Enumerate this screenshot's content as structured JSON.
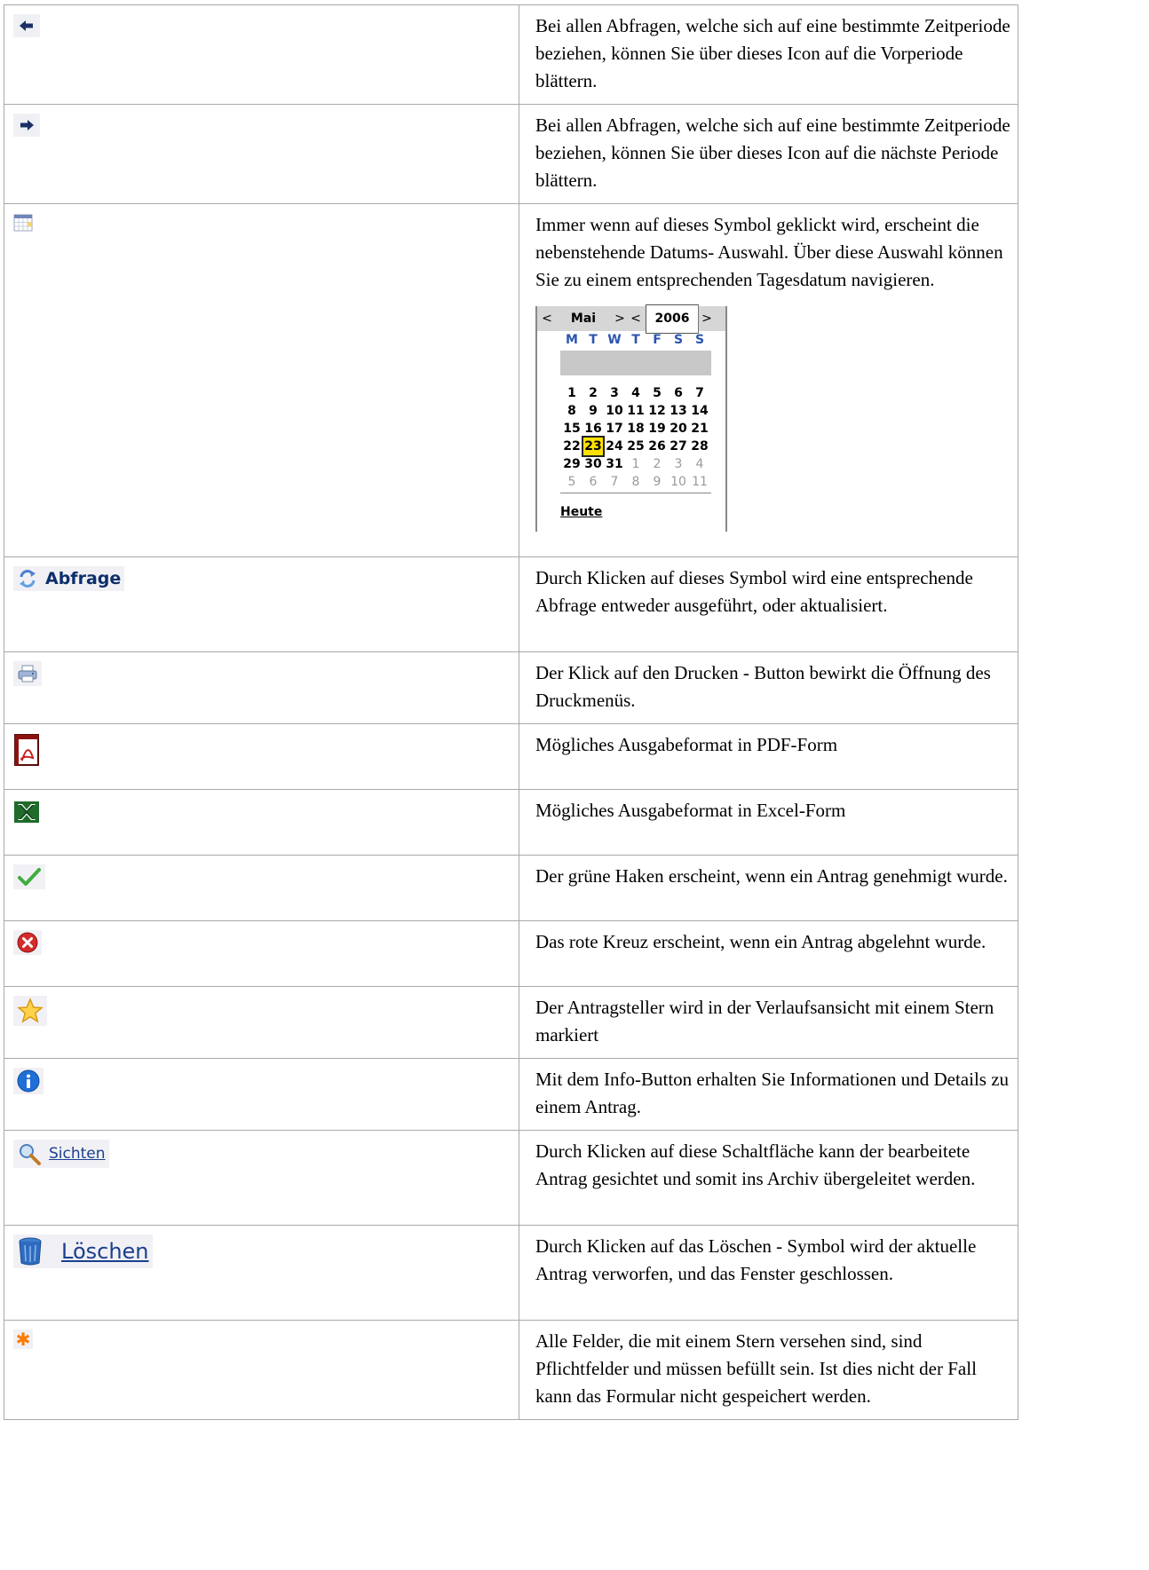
{
  "rows": [
    {
      "icon": "arrow-left-icon",
      "text": "Bei allen Abfragen, welche sich auf eine bestimmte Zeitperiode beziehen, können Sie über dieses Icon auf die Vorperiode blättern."
    },
    {
      "icon": "arrow-right-icon",
      "text": "Bei allen Abfragen, welche sich auf eine bestimmte Zeitperiode beziehen, können Sie über dieses Icon auf die nächste Periode blättern."
    },
    {
      "icon": "calendar-icon",
      "text": "Immer wenn auf dieses Symbol geklickt wird, erscheint die nebenstehende Datums- Auswahl. Über diese Auswahl können Sie zu einem entsprechenden Tagesdatum navigieren."
    },
    {
      "icon": "refresh-icon",
      "label": "Abfrage",
      "text": "Durch Klicken auf dieses Symbol wird eine entsprechende Abfrage entweder ausgeführt, oder aktualisiert."
    },
    {
      "icon": "printer-icon",
      "text": "Der Klick auf den Drucken - Button bewirkt die Öffnung des Druckmenüs."
    },
    {
      "icon": "pdf-icon",
      "text": "Mögliches Ausgabeformat in PDF-Form"
    },
    {
      "icon": "excel-icon",
      "text": "Mögliches Ausgabeformat in Excel-Form"
    },
    {
      "icon": "checkmark-icon",
      "text": "Der grüne Haken erscheint, wenn ein Antrag genehmigt wurde."
    },
    {
      "icon": "red-cross-icon",
      "text": "Das rote Kreuz erscheint, wenn ein Antrag abgelehnt wurde."
    },
    {
      "icon": "star-icon",
      "text": "Der Antragsteller wird in der Verlaufsansicht mit einem Stern markiert"
    },
    {
      "icon": "info-icon",
      "text": "Mit dem Info-Button erhalten Sie Informationen und Details zu einem Antrag."
    },
    {
      "icon": "magnifier-icon",
      "label": "Sichten",
      "text": "Durch Klicken auf diese Schaltfläche kann der bearbeitete Antrag gesichtet und somit ins Archiv übergeleitet werden."
    },
    {
      "icon": "trash-icon",
      "label": "Löschen",
      "text": "Durch Klicken auf das Löschen - Symbol wird der aktuelle Antrag verworfen, und das Fenster geschlossen."
    },
    {
      "icon": "asterisk-icon",
      "text": "Alle Felder, die mit einem Stern  versehen sind, sind Pflichtfelder und müssen befüllt sein. Ist dies nicht der Fall kann das Formular nicht gespeichert werden."
    }
  ],
  "calendar": {
    "prev": "<",
    "month": "Mai",
    "next": ">",
    "year_prev": "<",
    "year": "2006",
    "year_next": ">",
    "weekdays": [
      "M",
      "T",
      "W",
      "T",
      "F",
      "S",
      "S"
    ],
    "weeks": [
      [
        "1",
        "2",
        "3",
        "4",
        "5",
        "6",
        "7"
      ],
      [
        "8",
        "9",
        "10",
        "11",
        "12",
        "13",
        "14"
      ],
      [
        "15",
        "16",
        "17",
        "18",
        "19",
        "20",
        "21"
      ],
      [
        "22",
        "23",
        "24",
        "25",
        "26",
        "27",
        "28"
      ],
      [
        "29",
        "30",
        "31",
        "1",
        "2",
        "3",
        "4"
      ],
      [
        "5",
        "6",
        "7",
        "8",
        "9",
        "10",
        "11"
      ]
    ],
    "today": "23",
    "footer": "Heute"
  }
}
